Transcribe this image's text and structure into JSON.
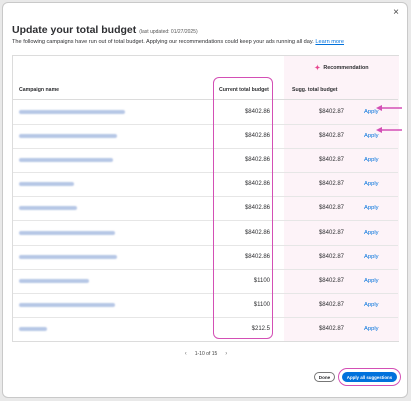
{
  "modal": {
    "close_glyph": "×",
    "title": "Update your total budget",
    "last_updated": "(last updated: 01/27/2025)",
    "description": "The following campaigns have run out of total budget. Applying our recommendations could keep your ads running all day.",
    "learn_more": "Learn more"
  },
  "table": {
    "recommendation_label": "Recommendation",
    "recommendation_icon": "sparkle-icon",
    "columns": {
      "campaign": "Campaign name",
      "current": "Current total budget",
      "suggested": "Sugg. total budget"
    },
    "rows": [
      {
        "current": "$8402.86",
        "suggested": "$8402.87",
        "action": "Apply"
      },
      {
        "current": "$8402.86",
        "suggested": "$8402.87",
        "action": "Apply"
      },
      {
        "current": "$8402.86",
        "suggested": "$8402.87",
        "action": "Apply"
      },
      {
        "current": "$8402.86",
        "suggested": "$8402.87",
        "action": "Apply"
      },
      {
        "current": "$8402.86",
        "suggested": "$8402.87",
        "action": "Apply"
      },
      {
        "current": "$8402.86",
        "suggested": "$8402.87",
        "action": "Apply"
      },
      {
        "current": "$8402.86",
        "suggested": "$8402.87",
        "action": "Apply"
      },
      {
        "current": "$1100",
        "suggested": "$8402.87",
        "action": "Apply"
      },
      {
        "current": "$1100",
        "suggested": "$8402.87",
        "action": "Apply"
      },
      {
        "current": "$212.5",
        "suggested": "$8402.87",
        "action": "Apply"
      }
    ]
  },
  "pagination": {
    "range": "1-10 of 15",
    "prev_glyph": "‹",
    "next_glyph": "›"
  },
  "footer": {
    "done_label": "Done",
    "apply_all_label": "Apply all suggestions"
  },
  "colors": {
    "accent_blue": "#0071dc",
    "highlight_pink": "#d34fb5",
    "recommendation_band": "#fdf3f8"
  }
}
